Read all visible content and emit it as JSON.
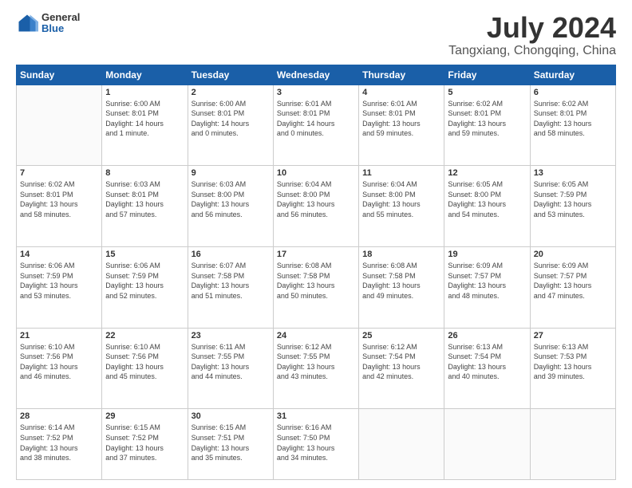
{
  "logo": {
    "general": "General",
    "blue": "Blue"
  },
  "title": {
    "month": "July 2024",
    "location": "Tangxiang, Chongqing, China"
  },
  "weekdays": [
    "Sunday",
    "Monday",
    "Tuesday",
    "Wednesday",
    "Thursday",
    "Friday",
    "Saturday"
  ],
  "weeks": [
    [
      {
        "date": "",
        "info": ""
      },
      {
        "date": "1",
        "info": "Sunrise: 6:00 AM\nSunset: 8:01 PM\nDaylight: 14 hours\nand 1 minute."
      },
      {
        "date": "2",
        "info": "Sunrise: 6:00 AM\nSunset: 8:01 PM\nDaylight: 14 hours\nand 0 minutes."
      },
      {
        "date": "3",
        "info": "Sunrise: 6:01 AM\nSunset: 8:01 PM\nDaylight: 14 hours\nand 0 minutes."
      },
      {
        "date": "4",
        "info": "Sunrise: 6:01 AM\nSunset: 8:01 PM\nDaylight: 13 hours\nand 59 minutes."
      },
      {
        "date": "5",
        "info": "Sunrise: 6:02 AM\nSunset: 8:01 PM\nDaylight: 13 hours\nand 59 minutes."
      },
      {
        "date": "6",
        "info": "Sunrise: 6:02 AM\nSunset: 8:01 PM\nDaylight: 13 hours\nand 58 minutes."
      }
    ],
    [
      {
        "date": "7",
        "info": "Sunrise: 6:02 AM\nSunset: 8:01 PM\nDaylight: 13 hours\nand 58 minutes."
      },
      {
        "date": "8",
        "info": "Sunrise: 6:03 AM\nSunset: 8:01 PM\nDaylight: 13 hours\nand 57 minutes."
      },
      {
        "date": "9",
        "info": "Sunrise: 6:03 AM\nSunset: 8:00 PM\nDaylight: 13 hours\nand 56 minutes."
      },
      {
        "date": "10",
        "info": "Sunrise: 6:04 AM\nSunset: 8:00 PM\nDaylight: 13 hours\nand 56 minutes."
      },
      {
        "date": "11",
        "info": "Sunrise: 6:04 AM\nSunset: 8:00 PM\nDaylight: 13 hours\nand 55 minutes."
      },
      {
        "date": "12",
        "info": "Sunrise: 6:05 AM\nSunset: 8:00 PM\nDaylight: 13 hours\nand 54 minutes."
      },
      {
        "date": "13",
        "info": "Sunrise: 6:05 AM\nSunset: 7:59 PM\nDaylight: 13 hours\nand 53 minutes."
      }
    ],
    [
      {
        "date": "14",
        "info": "Sunrise: 6:06 AM\nSunset: 7:59 PM\nDaylight: 13 hours\nand 53 minutes."
      },
      {
        "date": "15",
        "info": "Sunrise: 6:06 AM\nSunset: 7:59 PM\nDaylight: 13 hours\nand 52 minutes."
      },
      {
        "date": "16",
        "info": "Sunrise: 6:07 AM\nSunset: 7:58 PM\nDaylight: 13 hours\nand 51 minutes."
      },
      {
        "date": "17",
        "info": "Sunrise: 6:08 AM\nSunset: 7:58 PM\nDaylight: 13 hours\nand 50 minutes."
      },
      {
        "date": "18",
        "info": "Sunrise: 6:08 AM\nSunset: 7:58 PM\nDaylight: 13 hours\nand 49 minutes."
      },
      {
        "date": "19",
        "info": "Sunrise: 6:09 AM\nSunset: 7:57 PM\nDaylight: 13 hours\nand 48 minutes."
      },
      {
        "date": "20",
        "info": "Sunrise: 6:09 AM\nSunset: 7:57 PM\nDaylight: 13 hours\nand 47 minutes."
      }
    ],
    [
      {
        "date": "21",
        "info": "Sunrise: 6:10 AM\nSunset: 7:56 PM\nDaylight: 13 hours\nand 46 minutes."
      },
      {
        "date": "22",
        "info": "Sunrise: 6:10 AM\nSunset: 7:56 PM\nDaylight: 13 hours\nand 45 minutes."
      },
      {
        "date": "23",
        "info": "Sunrise: 6:11 AM\nSunset: 7:55 PM\nDaylight: 13 hours\nand 44 minutes."
      },
      {
        "date": "24",
        "info": "Sunrise: 6:12 AM\nSunset: 7:55 PM\nDaylight: 13 hours\nand 43 minutes."
      },
      {
        "date": "25",
        "info": "Sunrise: 6:12 AM\nSunset: 7:54 PM\nDaylight: 13 hours\nand 42 minutes."
      },
      {
        "date": "26",
        "info": "Sunrise: 6:13 AM\nSunset: 7:54 PM\nDaylight: 13 hours\nand 40 minutes."
      },
      {
        "date": "27",
        "info": "Sunrise: 6:13 AM\nSunset: 7:53 PM\nDaylight: 13 hours\nand 39 minutes."
      }
    ],
    [
      {
        "date": "28",
        "info": "Sunrise: 6:14 AM\nSunset: 7:52 PM\nDaylight: 13 hours\nand 38 minutes."
      },
      {
        "date": "29",
        "info": "Sunrise: 6:15 AM\nSunset: 7:52 PM\nDaylight: 13 hours\nand 37 minutes."
      },
      {
        "date": "30",
        "info": "Sunrise: 6:15 AM\nSunset: 7:51 PM\nDaylight: 13 hours\nand 35 minutes."
      },
      {
        "date": "31",
        "info": "Sunrise: 6:16 AM\nSunset: 7:50 PM\nDaylight: 13 hours\nand 34 minutes."
      },
      {
        "date": "",
        "info": ""
      },
      {
        "date": "",
        "info": ""
      },
      {
        "date": "",
        "info": ""
      }
    ]
  ]
}
